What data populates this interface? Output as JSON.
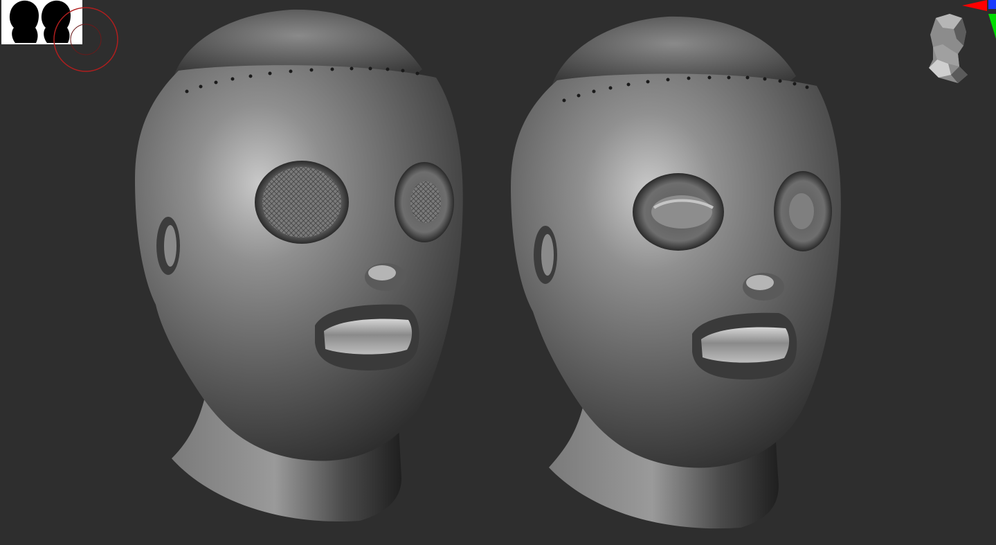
{
  "viewport": {
    "background": "#2e2e2e",
    "model_color": "#6d6d6d",
    "models": [
      {
        "name": "head-mask-mesh-eyes",
        "eye_style": "mesh-covered"
      },
      {
        "name": "head-mask-open-eyes",
        "eye_style": "open"
      }
    ]
  },
  "overlays": {
    "silhouette_panel_bg": "#ffffff",
    "silhouette_fill": "#000000",
    "brush_ring_color": "#b01e1e",
    "axis_colors": {
      "x": "#ff0000",
      "y": "#00dd00",
      "z": "#1a3cff"
    }
  }
}
